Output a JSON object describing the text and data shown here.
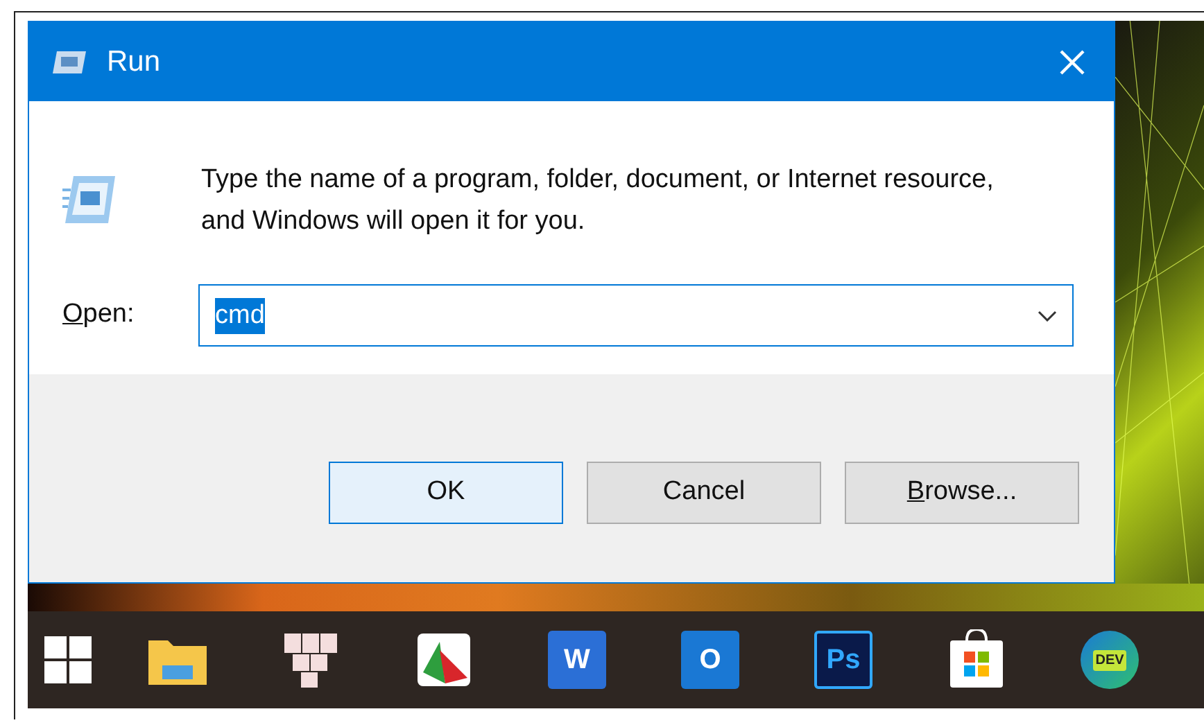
{
  "dialog": {
    "title": "Run",
    "message": "Type the name of a program, folder, document, or Internet resource, and Windows will open it for you.",
    "open_label": {
      "mnemonic": "O",
      "rest": "pen:"
    },
    "open_field": {
      "value": "cmd",
      "text_selected": true
    },
    "buttons": [
      {
        "label": "OK",
        "default": true
      },
      {
        "label": "Cancel",
        "default": false
      },
      {
        "label": "rowse...",
        "mnemonic": "B",
        "default": false
      }
    ]
  },
  "taskbar": {
    "apps": [
      {
        "kind": "start"
      },
      {
        "kind": "explorer"
      },
      {
        "kind": "tiles"
      },
      {
        "kind": "reader"
      },
      {
        "kind": "word",
        "glyph": "W"
      },
      {
        "kind": "outlook",
        "glyph": "O"
      },
      {
        "kind": "photoshop",
        "glyph": "Ps"
      },
      {
        "kind": "store"
      },
      {
        "kind": "edge",
        "glyph": "DEV"
      }
    ]
  }
}
